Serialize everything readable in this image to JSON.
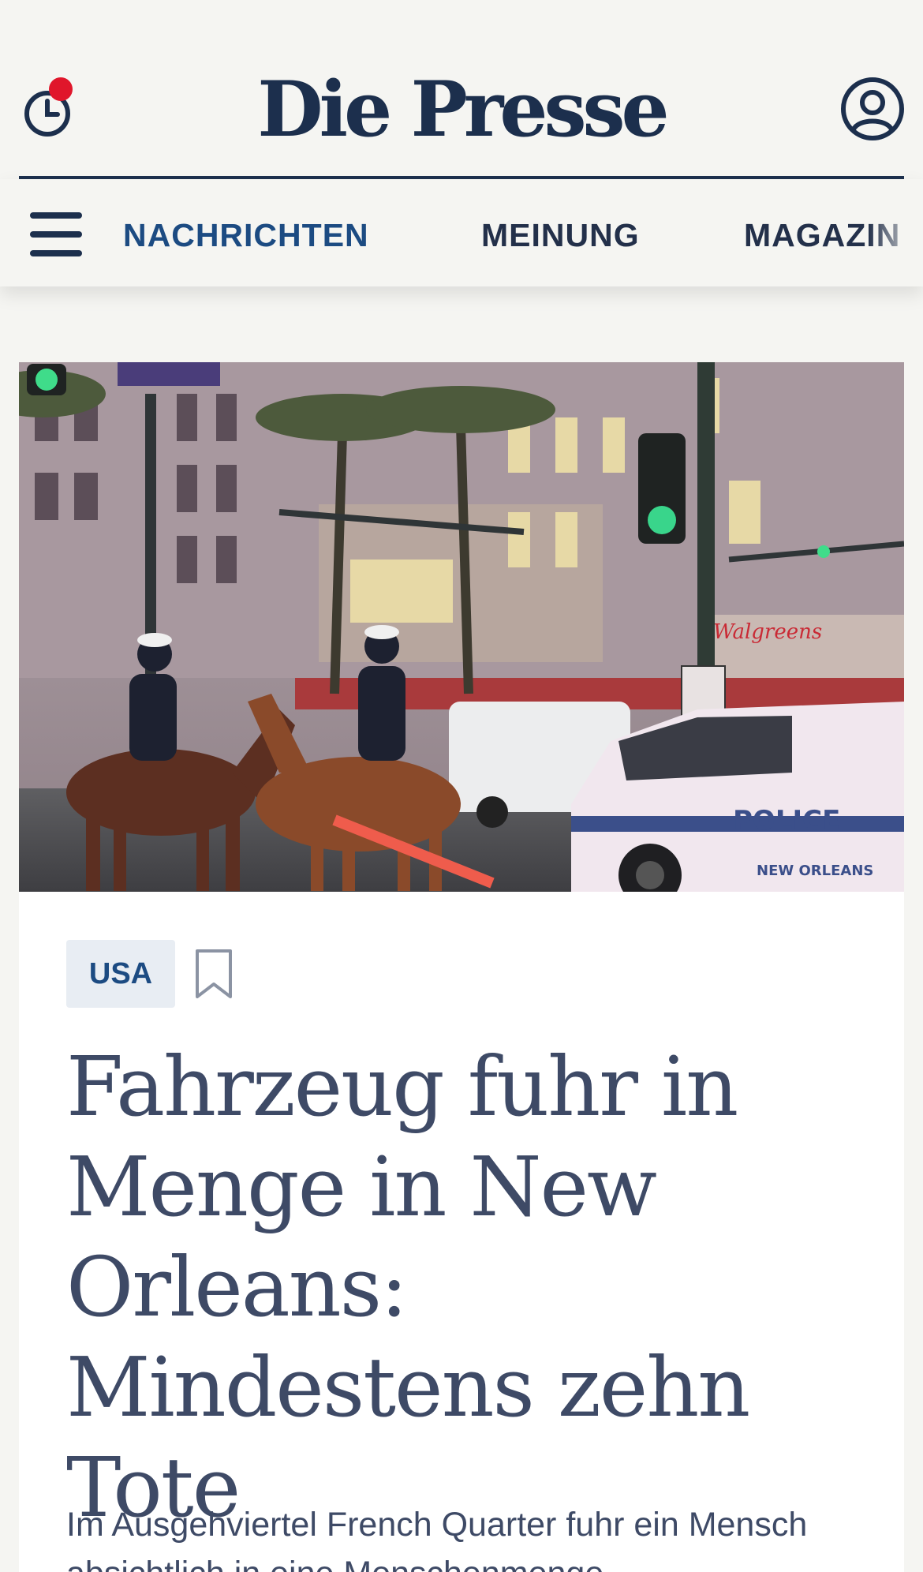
{
  "header": {
    "logo": "Die Presse",
    "history_icon": "clock-history-icon",
    "account_icon": "user-account-icon",
    "notification_color": "#e0162b"
  },
  "nav": {
    "menu_icon": "hamburger-menu-icon",
    "items": [
      {
        "label": "NACHRICHTEN",
        "active": true
      },
      {
        "label": "MEINUNG",
        "active": false
      },
      {
        "label": "MAGAZIN",
        "active": false
      }
    ]
  },
  "article": {
    "image_description_icon": "news-photo-police-on-horseback",
    "tag": "USA",
    "bookmark_icon": "bookmark-icon",
    "headline": "Fahrzeug fuhr in Menge in New Orleans: Mindestens zehn Tote",
    "teaser": "Im Ausgehviertel French Quarter fuhr ein Mensch absichtlich in eine Menschenmenge"
  },
  "colors": {
    "brand_navy": "#1c2f4d",
    "active_blue": "#1c4b82",
    "headline": "#3e4a66",
    "background": "#f5f5f2"
  }
}
